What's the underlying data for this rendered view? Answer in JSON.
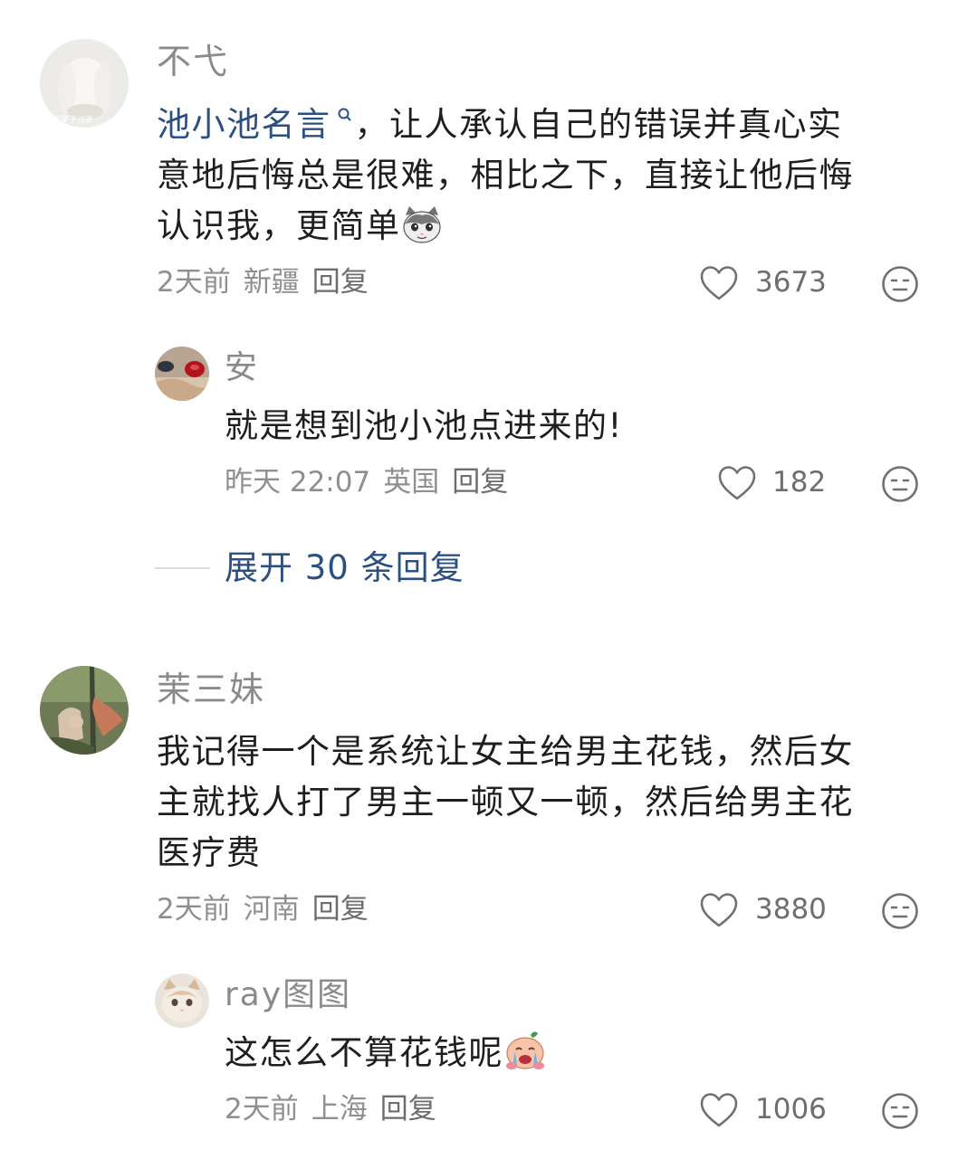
{
  "comments": [
    {
      "username": "不弋",
      "avatar_caption": "和栗子过家",
      "text_link": "池小池名言",
      "text_rest_line1": "，让人承认自己的错误并真心实",
      "text_line2": "意地后悔总是很难，相比之下，直接让他后悔",
      "text_line3": "认识我，更简单",
      "time": "2天前",
      "location": "新疆",
      "reply": "回复",
      "likes": "3673",
      "replies": [
        {
          "username": "安",
          "text": "就是想到池小池点进来的!",
          "time": "昨天 22:07",
          "location": "英国",
          "reply": "回复",
          "likes": "182"
        }
      ],
      "expand_label": "展开 30 条回复"
    },
    {
      "username": "茉三妹",
      "text_line1": "我记得一个是系统让女主给男主花钱，然后女",
      "text_line2": "主就找人打了男主一顿又一顿，然后给男主花",
      "text_line3": "医疗费",
      "time": "2天前",
      "location": "河南",
      "reply": "回复",
      "likes": "3880",
      "replies": [
        {
          "username": "ray图图",
          "text": "这怎么不算花钱呢",
          "time": "2天前",
          "location": "上海",
          "reply": "回复",
          "likes": "1006"
        }
      ]
    }
  ],
  "icons": {
    "like": "heart-outline-icon",
    "dislike": "meh-face-icon",
    "search": "search-icon"
  },
  "colors": {
    "link": "#2c4f82",
    "meta": "#8f8f8f",
    "username": "#8a8a8a"
  }
}
